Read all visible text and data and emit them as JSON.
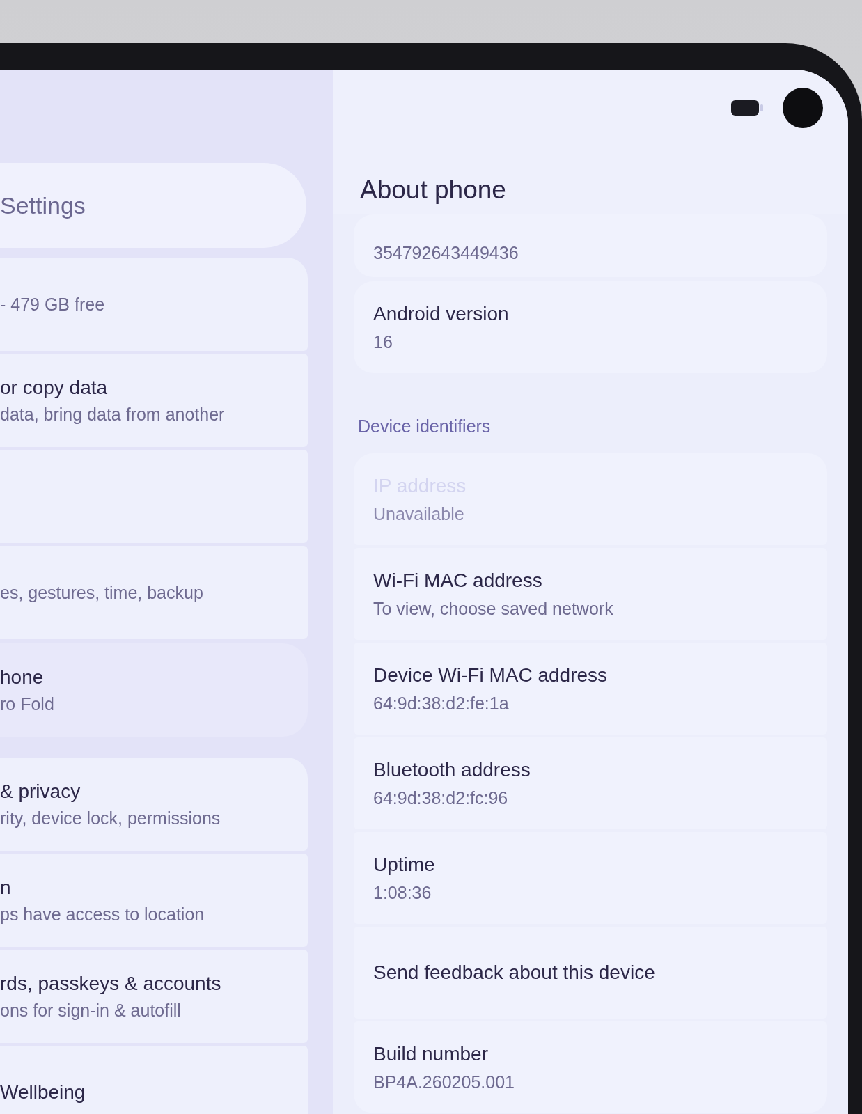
{
  "settings_list": {
    "search": {
      "placeholder": "Settings"
    },
    "groups": [
      {
        "items": [
          {
            "summary": "- 479 GB free",
            "selected": false
          },
          {
            "title": "or copy data",
            "summary": "data, bring data from another",
            "selected": false
          },
          {
            "selected": false
          },
          {
            "summary": "es, gestures, time, backup",
            "selected": false
          },
          {
            "title": "hone",
            "summary": "ro Fold",
            "selected": true
          }
        ]
      },
      {
        "items": [
          {
            "title": "& privacy",
            "summary": "rity, device lock, permissions",
            "selected": false
          },
          {
            "title": "n",
            "summary": "ps have access to location",
            "selected": false
          },
          {
            "title": "rds, passkeys & accounts",
            "summary": "ons for sign-in & autofill",
            "selected": false
          },
          {
            "title": "Wellbeing",
            "selected": false
          }
        ]
      }
    ]
  },
  "about": {
    "title": "About phone",
    "groups": [
      {
        "items": [
          {
            "value": "354792643449436",
            "disabled": false
          }
        ]
      },
      {
        "items": [
          {
            "label": "Android version",
            "value": "16",
            "disabled": false
          }
        ]
      },
      {
        "heading": "Device identifiers",
        "items": [
          {
            "label": "IP address",
            "value": "Unavailable",
            "disabled": true
          },
          {
            "label": "Wi-Fi MAC address",
            "value": "To view, choose saved network",
            "disabled": false
          },
          {
            "label": "Device Wi-Fi MAC address",
            "value": "64:9d:38:d2:fe:1a",
            "disabled": false
          },
          {
            "label": "Bluetooth address",
            "value": "64:9d:38:d2:fc:96",
            "disabled": false
          },
          {
            "label": "Uptime",
            "value": "1:08:36",
            "disabled": false
          },
          {
            "label": "Send feedback about this device",
            "disabled": false
          },
          {
            "label": "Build number",
            "value": "BP4A.260205.001",
            "disabled": false
          }
        ]
      }
    ]
  }
}
